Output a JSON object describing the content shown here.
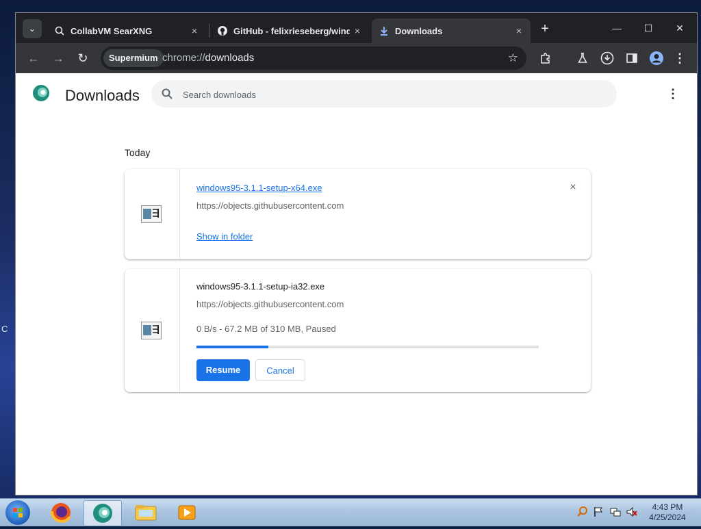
{
  "desktop": {
    "side_text": "C"
  },
  "tabs": [
    {
      "title": "CollabVM SearXNG",
      "icon": "searxng-icon"
    },
    {
      "title": "GitHub - felixrieseberg/windov",
      "icon": "github-icon"
    },
    {
      "title": "Downloads",
      "icon": "download-icon",
      "active": true
    }
  ],
  "tab_close_label": "×",
  "new_tab_label": "+",
  "window_controls": {
    "minimize": "—",
    "maximize": "☐",
    "close": "✕"
  },
  "toolbar": {
    "back": "←",
    "forward": "→",
    "reload": "↻",
    "site_chip": "Supermium",
    "url_scheme": "chrome://",
    "url_path": "downloads",
    "bookmark": "☆"
  },
  "page": {
    "title": "Downloads",
    "search_placeholder": "Search downloads",
    "menu": "⋮",
    "day_label": "Today"
  },
  "downloads": [
    {
      "filename": "windows95-3.1.1-setup-x64.exe",
      "url": "https://objects.githubusercontent.com",
      "action_link": "Show in folder",
      "remove": "×"
    },
    {
      "filename": "windows95-3.1.1-setup-ia32.exe",
      "url": "https://objects.githubusercontent.com",
      "status": "0 B/s - 67.2 MB of 310 MB, Paused",
      "progress_fraction": 0.21,
      "resume_label": "Resume",
      "cancel_label": "Cancel"
    }
  ],
  "taskbar": {
    "time": "4:43 PM",
    "date": "4/25/2024"
  },
  "colors": {
    "accent": "#1a73e8",
    "tabstrip": "#202124",
    "toolbar": "#35363a"
  }
}
